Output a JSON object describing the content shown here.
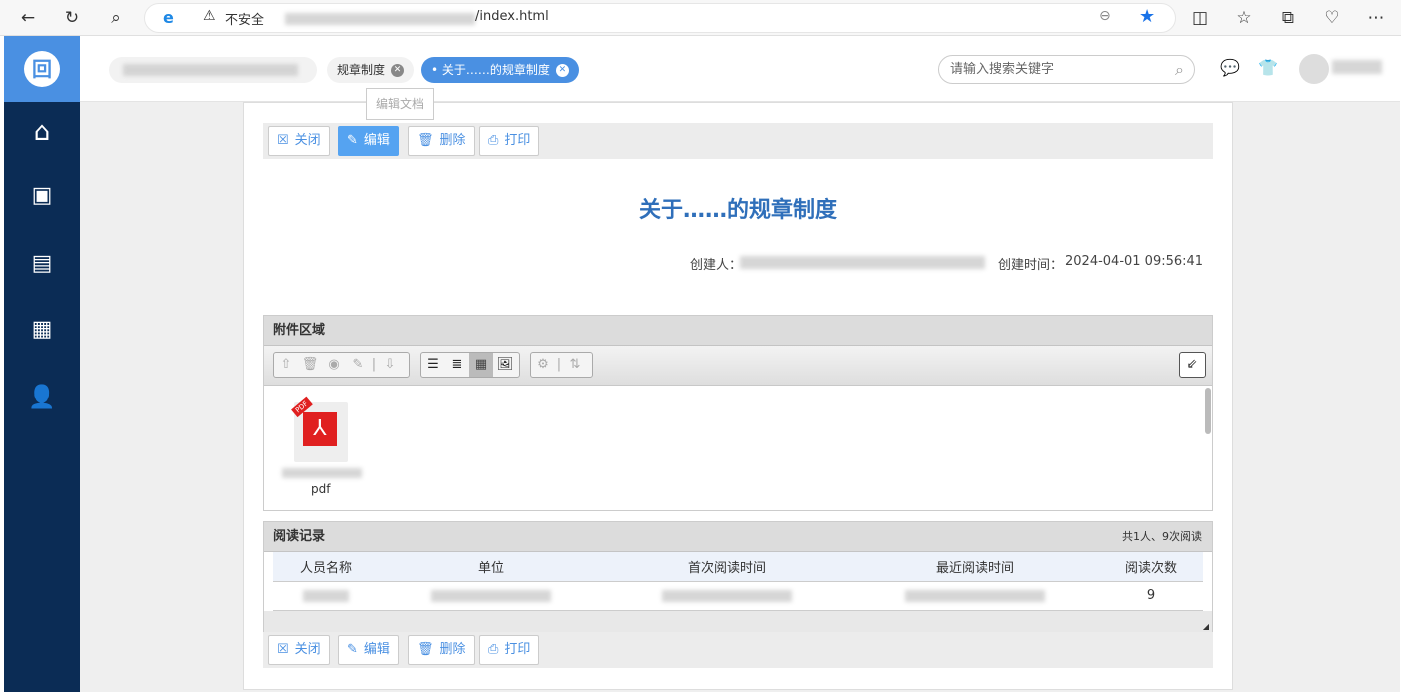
{
  "browser": {
    "security_label": "不安全",
    "url_suffix": "/index.html"
  },
  "header": {
    "tabs": [
      {
        "label": "规章制度"
      },
      {
        "label": "关于……的规章制度"
      }
    ],
    "tooltip": "编辑文档",
    "search_placeholder": "请输入搜索关键字"
  },
  "toolbar": {
    "close": "关闭",
    "edit": "编辑",
    "delete": "删除",
    "print": "打印"
  },
  "document": {
    "title": "关于……的规章制度",
    "creator_label": "创建人：",
    "created_time_label": "创建时间：",
    "created_time": "2024-04-01 09:56:41"
  },
  "attachments": {
    "title": "附件区域",
    "file_ext": "pdf",
    "pdf_badge": "PDF"
  },
  "reading": {
    "title": "阅读记录",
    "summary": "共1人、9次阅读",
    "columns": [
      "人员名称",
      "单位",
      "首次阅读时间",
      "最近阅读时间",
      "阅读次数"
    ],
    "rows": [
      {
        "count": "9"
      }
    ]
  },
  "colors": {
    "accent": "#4a90e2",
    "sidebar": "#0b2c55",
    "title": "#2f6fba"
  }
}
